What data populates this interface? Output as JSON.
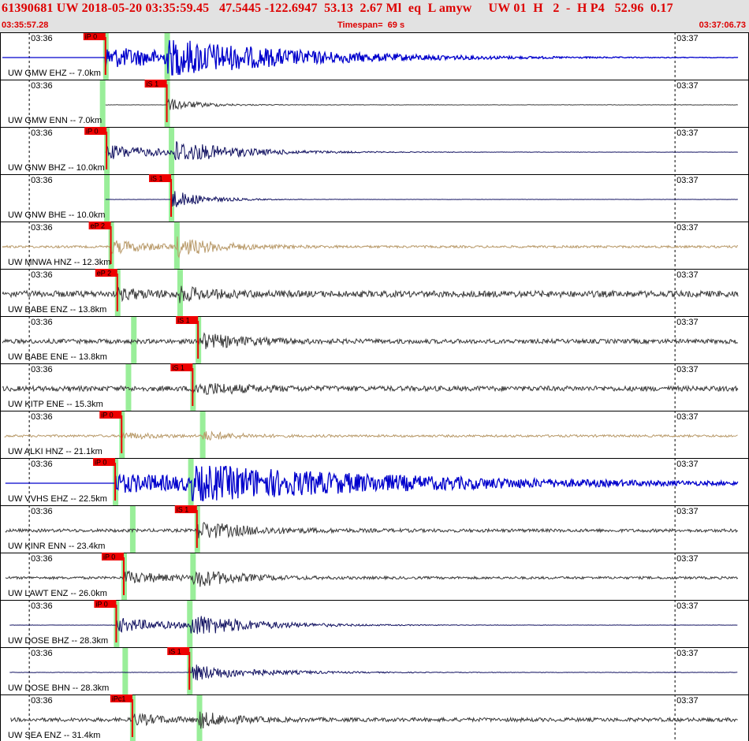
{
  "header": {
    "title": "61390681 UW 2018-05-20 03:35:59.45   47.5445 -122.6947  53.13  2.67 Ml  eq  L amyw     UW 01  H   2  -  H P4   52.96  0.17",
    "start_time": "03:35:57.28",
    "timespan_label": "Timespan=  69 s",
    "end_time": "03:37:06.73"
  },
  "colors": {
    "pick_red": "#ee0000",
    "s_wave_band": "#99ee99",
    "blue": "#0000cc",
    "navy": "#101060",
    "gray": "#3a3a3a",
    "tan": "#b89968"
  },
  "chart_data": {
    "type": "seismogram",
    "x_unit": "seconds after 03:35:57.28",
    "x_range": [
      0,
      69.45
    ],
    "time_ticks": [
      {
        "label": "03:36",
        "t": 2.72
      },
      {
        "label": "03:37",
        "t": 62.72
      }
    ],
    "traces": [
      {
        "label": "UW GMW EHZ -- 7.0km",
        "color": "blue",
        "pick": "iP 0",
        "pick_t": 9.8,
        "s_t": 15.5,
        "noise": 0.0,
        "event": 1.0,
        "decay": 12,
        "start_t": 0.0
      },
      {
        "label": "UW GMW ENN -- 7.0km",
        "color": "gray",
        "pick": "iS 1",
        "pick_t": 15.5,
        "s_t": 15.5,
        "noise": 0.03,
        "event": 0.6,
        "decay": 3,
        "start_t": 9.8
      },
      {
        "label": "UW GNW BHZ -- 10.0km",
        "color": "navy",
        "pick": "iP 0",
        "pick_t": 9.9,
        "s_t": 15.9,
        "noise": 0.02,
        "event": 0.7,
        "decay": 6,
        "start_t": 9.8
      },
      {
        "label": "UW GNW BHE -- 10.0km",
        "color": "navy",
        "pick": "iS 1",
        "pick_t": 15.9,
        "s_t": 15.9,
        "noise": 0.02,
        "event": 0.9,
        "decay": 3,
        "start_t": 9.8
      },
      {
        "label": "UW MNWA HNZ -- 12.3km",
        "color": "tan",
        "pick": "eP 2",
        "pick_t": 10.3,
        "s_t": 16.4,
        "noise": 0.18,
        "event": 0.6,
        "decay": 4,
        "start_t": 0.0
      },
      {
        "label": "UW BABE ENZ -- 13.8km",
        "color": "gray",
        "pick": "eP 2",
        "pick_t": 10.9,
        "s_t": 16.7,
        "noise": 0.5,
        "event": 0.4,
        "decay": 3,
        "start_t": 0.0
      },
      {
        "label": "UW BABE ENE -- 13.8km",
        "color": "gray",
        "pick": "iS 1",
        "pick_t": 18.4,
        "s_t": 18.4,
        "noise": 0.35,
        "event": 0.7,
        "decay": 4,
        "start_t": 0.0
      },
      {
        "label": "UW KITP ENE -- 15.3km",
        "color": "gray",
        "pick": "iS 1",
        "pick_t": 17.9,
        "s_t": 17.9,
        "noise": 0.4,
        "event": 0.6,
        "decay": 4,
        "start_t": 0.0
      },
      {
        "label": "UW ALKI HNZ -- 21.1km",
        "color": "tan",
        "pick": "iP 0",
        "pick_t": 11.3,
        "s_t": 18.8,
        "noise": 0.18,
        "event": 0.3,
        "decay": 3,
        "start_t": 0.4
      },
      {
        "label": "UW VVHS EHZ -- 22.5km",
        "color": "blue",
        "pick": "iP 0",
        "pick_t": 10.7,
        "s_t": 17.7,
        "noise": 0.0,
        "event": 0.9,
        "decay": 22,
        "start_t": 0.5
      },
      {
        "label": "UW KINR ENN -- 23.4km",
        "color": "gray",
        "pick": "iS 1",
        "pick_t": 18.3,
        "s_t": 18.3,
        "noise": 0.25,
        "event": 0.8,
        "decay": 5,
        "start_t": 0.5
      },
      {
        "label": "UW LAWT ENZ -- 26.0km",
        "color": "gray",
        "pick": "iP 0",
        "pick_t": 11.5,
        "s_t": 17.9,
        "noise": 0.2,
        "event": 0.6,
        "decay": 4,
        "start_t": 0.5
      },
      {
        "label": "UW DOSE BHZ -- 28.3km",
        "color": "navy",
        "pick": "iP 0",
        "pick_t": 10.8,
        "s_t": 17.6,
        "noise": 0.02,
        "event": 0.7,
        "decay": 6,
        "start_t": 0.9
      },
      {
        "label": "UW DOSE BHN -- 28.3km",
        "color": "navy",
        "pick": "iS 1",
        "pick_t": 17.6,
        "s_t": 17.6,
        "noise": 0.03,
        "event": 0.8,
        "decay": 6,
        "start_t": 0.9
      },
      {
        "label": "UW SEA ENZ -- 31.4km",
        "color": "gray",
        "pick": "iPc1",
        "pick_t": 12.3,
        "s_t": 18.5,
        "noise": 0.3,
        "event": 0.5,
        "decay": 3,
        "start_t": 1.0
      }
    ]
  }
}
